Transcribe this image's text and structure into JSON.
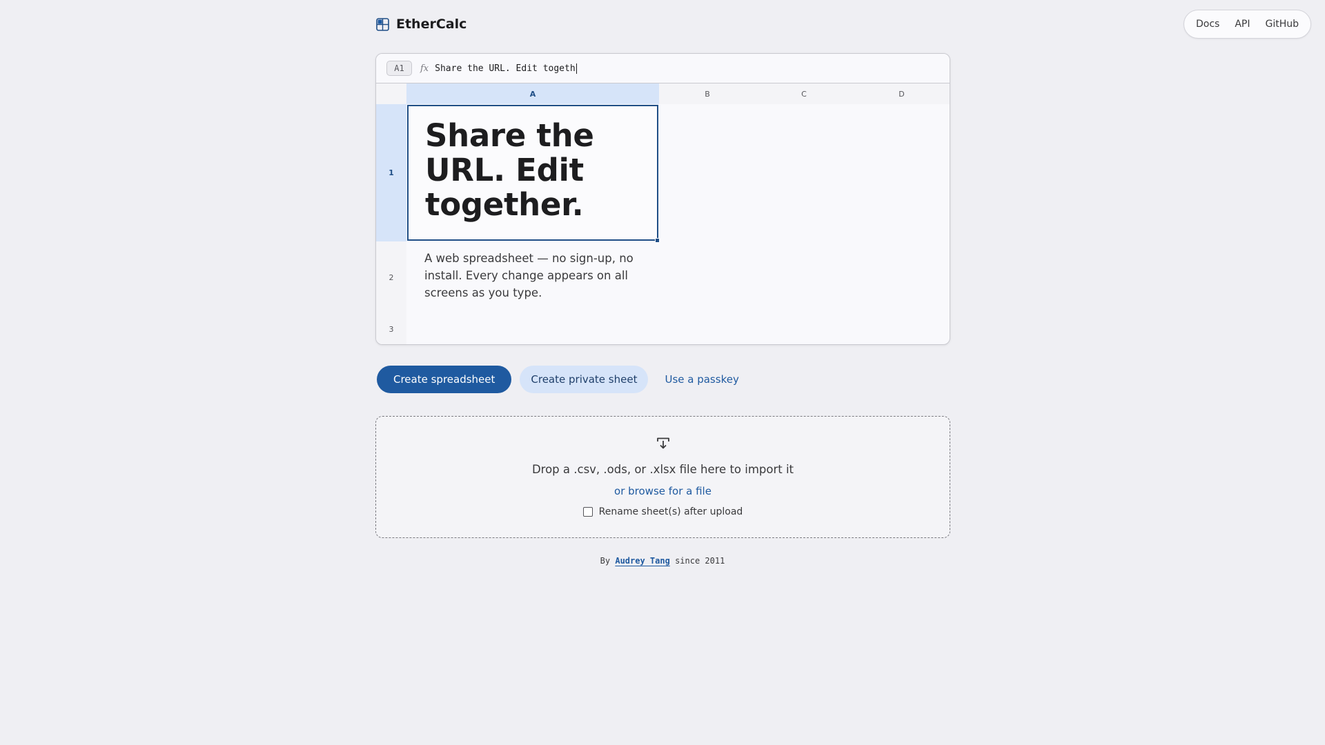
{
  "header": {
    "brand_name": "EtherCalc",
    "nav": [
      "Docs",
      "API",
      "GitHub"
    ]
  },
  "sheet": {
    "cell_ref": "A1",
    "fx_label": "fx",
    "formula_value": "Share the URL. Edit togeth",
    "columns": [
      "A",
      "B",
      "C",
      "D"
    ],
    "rows": [
      "1",
      "2",
      "3"
    ],
    "a1": "Share the URL. Edit together.",
    "a2": "A web spreadsheet — no sign-up, no install. Every change appears on all screens as you type."
  },
  "actions": {
    "create": "Create spreadsheet",
    "create_private": "Create private sheet",
    "passkey": "Use a passkey"
  },
  "dropzone": {
    "text": "Drop a .csv, .ods, or .xlsx file here to import it",
    "browse": "or browse for a file",
    "rename_label": "Rename sheet(s) after upload",
    "rename_checked": false
  },
  "footer": {
    "prefix": "By",
    "author": "Audrey Tang",
    "suffix": "since 2011"
  },
  "colors": {
    "accent": "#1f5aa0",
    "selection": "#d6e4f9",
    "background": "#efeff3"
  },
  "icons": {
    "brand": "grid-logo-icon",
    "import": "import-tray-icon"
  }
}
